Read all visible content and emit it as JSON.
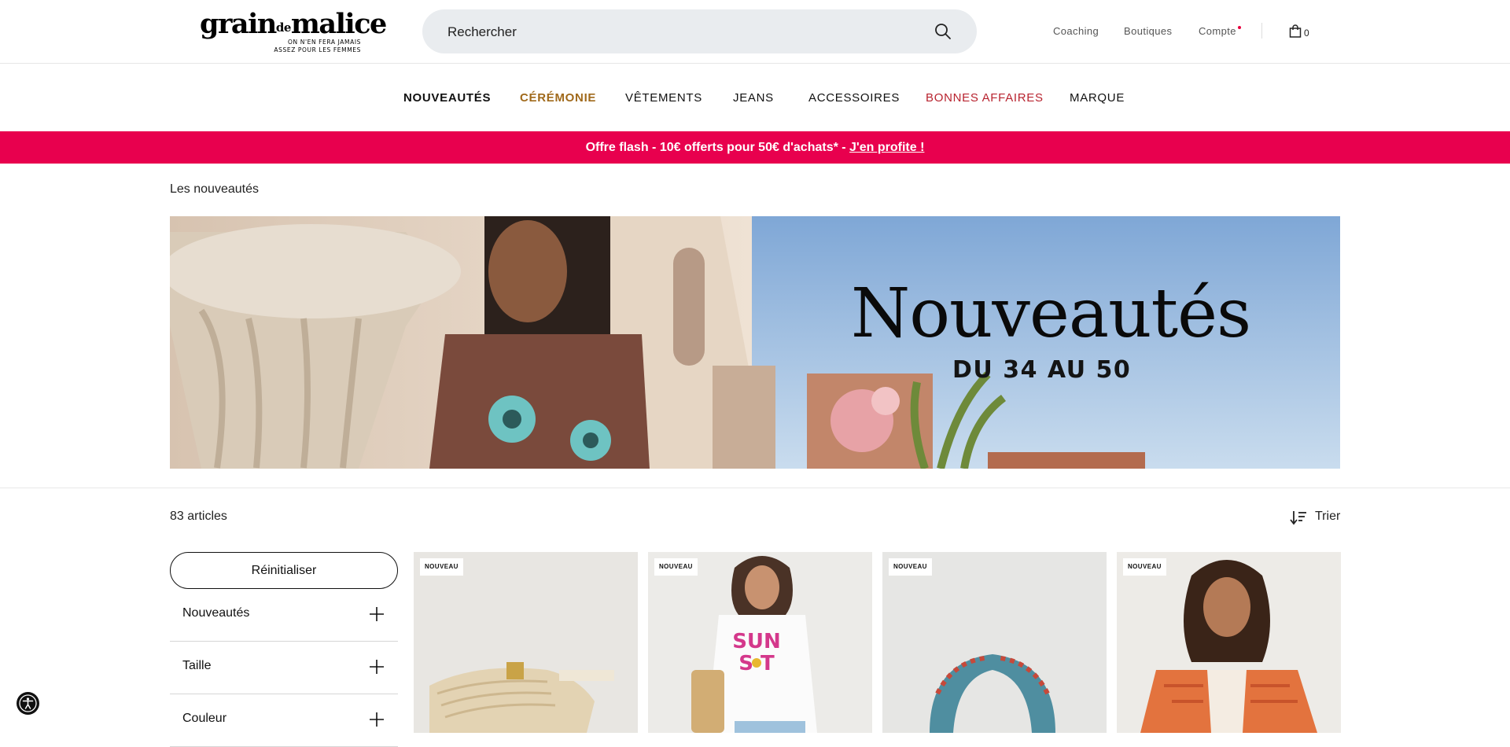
{
  "header": {
    "logo": {
      "name_main_1": "grain",
      "name_small": "de",
      "name_main_2": "malice",
      "tagline_line1": "ON N'EN FERA JAMAIS",
      "tagline_line2": "ASSEZ POUR LES FEMMES"
    },
    "search": {
      "placeholder": "Rechercher",
      "icon": "search-icon"
    },
    "links": [
      "Coaching",
      "Boutiques",
      "Compte"
    ],
    "cart": {
      "icon": "shopping-bag-icon",
      "count": "0"
    },
    "accent_color": "#e8003d"
  },
  "nav": {
    "items": [
      {
        "label": "NOUVEAUTÉS",
        "color": "#111111"
      },
      {
        "label": "CÉRÉMONIE",
        "color": "#a0691b"
      },
      {
        "label": "VÊTEMENTS",
        "color": "#111111"
      },
      {
        "label": "JEANS",
        "color": "#111111"
      },
      {
        "label": "ACCESSOIRES",
        "color": "#111111"
      },
      {
        "label": "BONNES AFFAIRES",
        "color": "#b8232f"
      },
      {
        "label": "MARQUE",
        "color": "#111111"
      }
    ]
  },
  "promo": {
    "text": "Offre flash - 10€ offerts pour 50€ d'achats* - ",
    "cta": "J'en profite !",
    "background": "#e8004e"
  },
  "breadcrumb": "Les nouveautés",
  "banner": {
    "title": "Nouveautés",
    "subtitle": "DU 34 AU 50"
  },
  "listing": {
    "count": "83 articles",
    "sort_label": "Trier",
    "sort_icon": "sort-icon"
  },
  "filters": {
    "reset_label": "Réinitialiser",
    "items": [
      "Nouveautés",
      "Taille",
      "Couleur"
    ]
  },
  "products": [
    {
      "badge": "NOUVEAU",
      "image": "beige-belt-bag"
    },
    {
      "badge": "NOUVEAU",
      "image": "sunset-tshirt-model"
    },
    {
      "badge": "NOUVEAU",
      "image": "blue-printed-scarf"
    },
    {
      "badge": "NOUVEAU",
      "image": "orange-kimono-model"
    }
  ],
  "product_print_text": {
    "line1": "SUN",
    "line2": "S T"
  },
  "accessibility": {
    "icon": "accessibility-icon"
  }
}
